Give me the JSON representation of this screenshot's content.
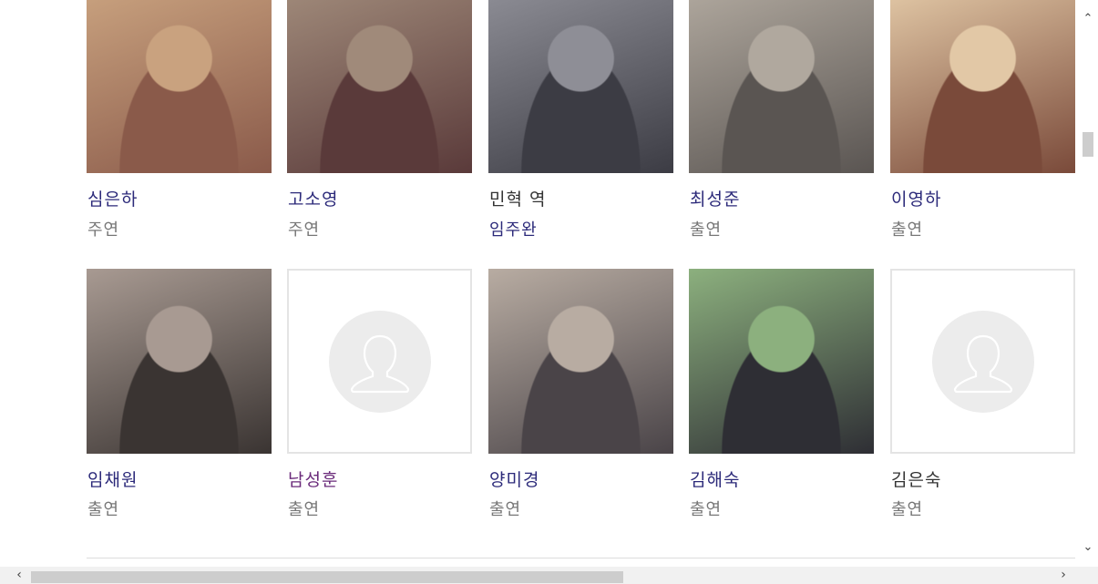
{
  "cast": [
    {
      "name": "심은하",
      "role": "주연",
      "role_is_link": false,
      "photo": "woman-long-brown-hair",
      "bg": [
        "#8a5a4a",
        "#c9a27f"
      ],
      "name_style": "link"
    },
    {
      "name": "고소영",
      "role": "주연",
      "role_is_link": false,
      "photo": "woman-posing-jewelry",
      "bg": [
        "#5a3a3a",
        "#a08a7a"
      ],
      "name_style": "link"
    },
    {
      "name": "민혁 역",
      "role": "임주완",
      "role_is_link": true,
      "photo": "man-suit-tie",
      "bg": [
        "#3c3c44",
        "#8e8e96"
      ],
      "name_style": "plain"
    },
    {
      "name": "최성준",
      "role": "출연",
      "role_is_link": false,
      "photo": "man-suit-bowtie",
      "bg": [
        "#5a5552",
        "#b0a89e"
      ],
      "name_style": "link"
    },
    {
      "name": "이영하",
      "role": "출연",
      "role_is_link": false,
      "photo": "man-white-jacket",
      "bg": [
        "#7a4a3a",
        "#e2c8a6"
      ],
      "name_style": "link"
    },
    {
      "name": "임채원",
      "role": "출연",
      "role_is_link": false,
      "photo": "woman-hand-on-cheek",
      "bg": [
        "#3a3432",
        "#a89a92"
      ],
      "name_style": "link"
    },
    {
      "name": "남성훈",
      "role": "출연",
      "role_is_link": false,
      "photo": "placeholder",
      "bg": null,
      "name_style": "visited"
    },
    {
      "name": "양미경",
      "role": "출연",
      "role_is_link": false,
      "photo": "woman-beige-sweater",
      "bg": [
        "#4a4448",
        "#b8aca2"
      ],
      "name_style": "link"
    },
    {
      "name": "김해숙",
      "role": "출연",
      "role_is_link": false,
      "photo": "woman-black-top",
      "bg": [
        "#2e2e34",
        "#8cb07e"
      ],
      "name_style": "link"
    },
    {
      "name": "김은숙",
      "role": "출연",
      "role_is_link": false,
      "photo": "placeholder",
      "bg": null,
      "name_style": "plain"
    }
  ],
  "icons": {
    "scroll_up": "chevron-up-icon",
    "scroll_down": "chevron-down-icon",
    "scroll_left": "chevron-left-icon",
    "scroll_right": "chevron-right-icon",
    "placeholder": "person-silhouette-icon"
  },
  "colors": {
    "link": "#2c2a7a",
    "visited": "#6a2a7a",
    "role": "#777777",
    "divider": "#dcdcdc"
  }
}
